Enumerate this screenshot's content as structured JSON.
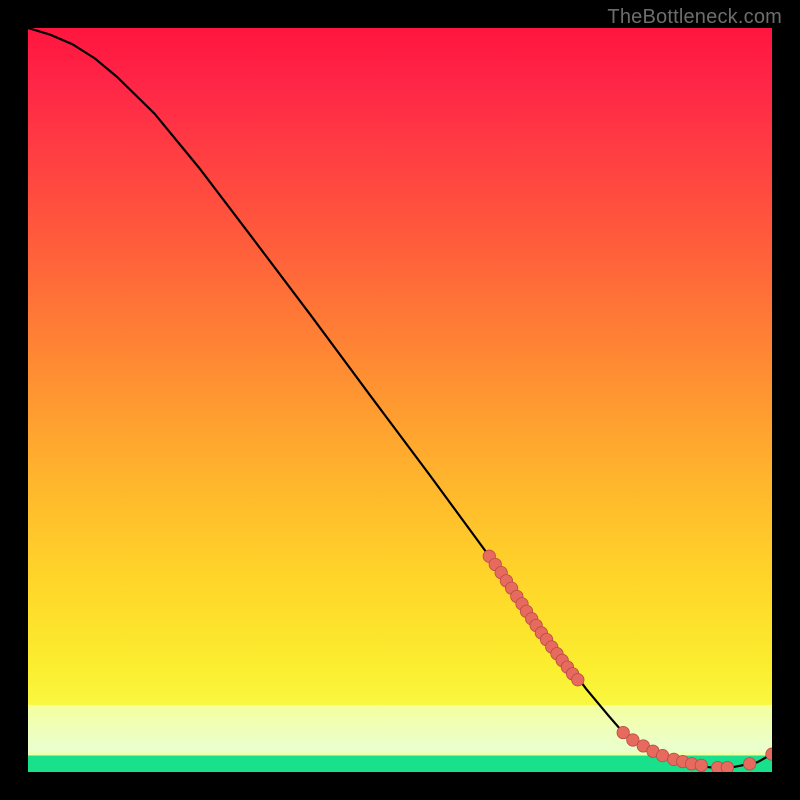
{
  "watermark": "TheBottleneck.com",
  "colors": {
    "background": "#000000",
    "curve": "#000000",
    "dot_fill": "#e76a5f",
    "dot_stroke": "#b84b43",
    "gradient_top": "#ff153e",
    "gradient_mid": "#ffd529",
    "gradient_low": "#f4ff6a",
    "green_band": "#19e08a"
  },
  "chart_data": {
    "type": "line",
    "title": "",
    "xlabel": "",
    "ylabel": "",
    "xlim": [
      0,
      100
    ],
    "ylim": [
      0,
      100
    ],
    "grid": false,
    "legend": null,
    "series": [
      {
        "name": "curve",
        "x": [
          0,
          3,
          6,
          9,
          12,
          17,
          23,
          30,
          38,
          46,
          54,
          62,
          68,
          72,
          75,
          78,
          80,
          83,
          86,
          89,
          92,
          95,
          98,
          100
        ],
        "y": [
          100,
          99.1,
          97.8,
          95.9,
          93.4,
          88.5,
          81.2,
          72.0,
          61.4,
          50.6,
          39.9,
          29.0,
          20.8,
          15.3,
          11.2,
          7.6,
          5.3,
          3.1,
          1.7,
          0.9,
          0.6,
          0.7,
          1.3,
          2.4
        ]
      }
    ],
    "markers": [
      {
        "name": "upper-dotted-segment",
        "x": [
          62.0,
          62.8,
          63.6,
          64.3,
          65.0,
          65.7,
          66.4,
          67.0,
          67.7,
          68.3,
          69.0,
          69.7,
          70.4,
          71.1,
          71.8,
          72.5,
          73.2,
          73.9
        ],
        "y": [
          29.0,
          27.9,
          26.8,
          25.7,
          24.7,
          23.6,
          22.6,
          21.6,
          20.6,
          19.7,
          18.7,
          17.8,
          16.8,
          15.9,
          15.0,
          14.1,
          13.2,
          12.4
        ]
      },
      {
        "name": "bottom-dotted-segment",
        "x": [
          80.0,
          81.3,
          82.7,
          84.0,
          85.3,
          86.8,
          88.0,
          89.2,
          90.5,
          92.7,
          94.0,
          97.0,
          100.0
        ],
        "y": [
          5.3,
          4.3,
          3.5,
          2.8,
          2.2,
          1.7,
          1.4,
          1.1,
          0.9,
          0.6,
          0.6,
          1.1,
          2.4
        ]
      }
    ]
  }
}
